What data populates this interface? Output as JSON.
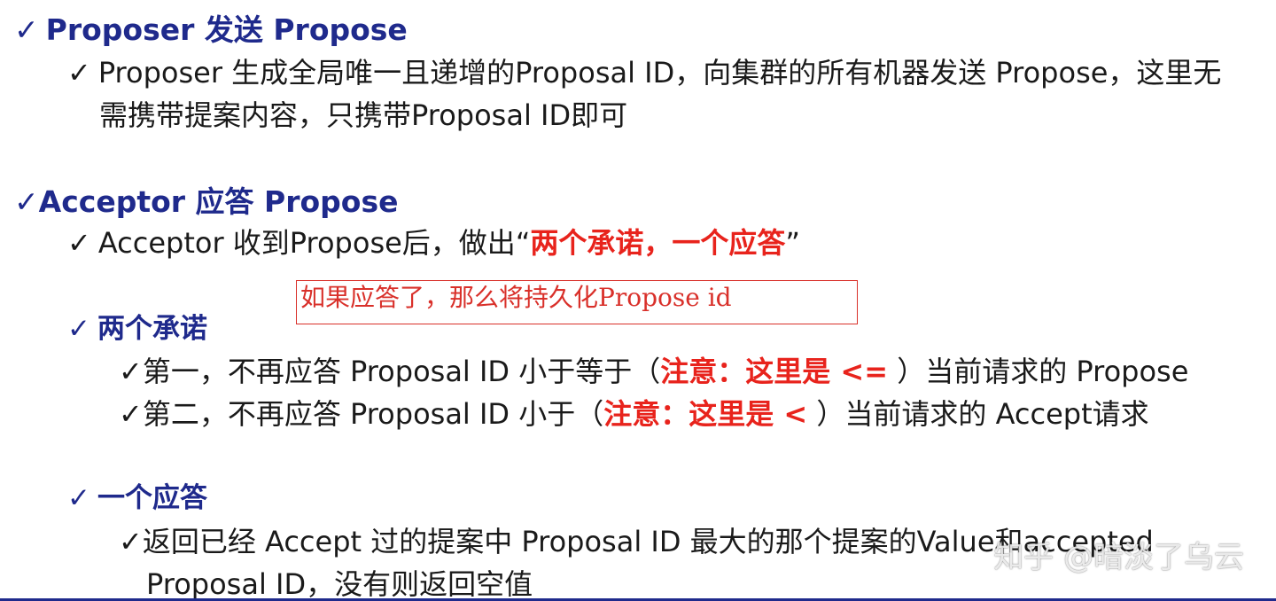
{
  "section1": {
    "heading": "Proposer 发送 Propose",
    "item_line1": "Proposer 生成全局唯一且递增的Proposal ID，向集群的所有机器发送 Propose，这里无",
    "item_line2": "需携带提案内容，只携带Proposal ID即可"
  },
  "section2": {
    "heading": "Acceptor 应答 Propose",
    "item_prefix": "Acceptor 收到Propose后，做出",
    "item_open_quote": "“",
    "item_emphasis": "两个承诺，一个应答",
    "item_close_quote": "”"
  },
  "annotation": {
    "text": "如果应答了，那么将持久化Propose id"
  },
  "promises": {
    "heading": "两个承诺",
    "first_prefix": "第一，不再应答 Proposal ID 小于等于（",
    "first_note": "注意：这里是 <=",
    "first_suffix": " ）当前请求的 Propose",
    "second_prefix": "第二，不再应答 Proposal ID 小于（",
    "second_note": "注意：这里是 <",
    "second_suffix": " ）当前请求的 Accept请求"
  },
  "response": {
    "heading": "一个应答",
    "line1": "返回已经 Accept 过的提案中 Proposal ID 最大的那个提案的Value和accepted",
    "line2": "Proposal ID，没有则返回空值"
  },
  "watermark": {
    "text": "知乎 @暗淡了乌云"
  },
  "icons": {
    "check": "✓"
  },
  "colors": {
    "heading_blue": "#1f2a8c",
    "emphasis_red": "#e8231c",
    "annotation_red": "#d9302a"
  }
}
